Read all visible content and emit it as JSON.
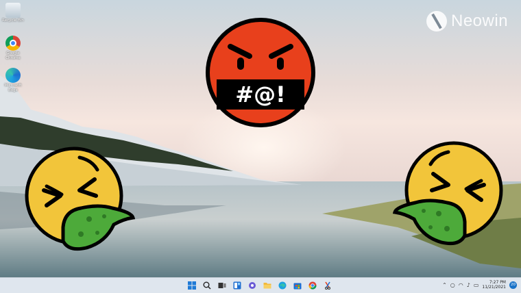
{
  "desktop": {
    "icons": [
      {
        "label": "Recycle Bin",
        "icon": "recycle-bin-icon"
      },
      {
        "label": "Google Chrome",
        "icon": "chrome-icon"
      },
      {
        "label": "Microsoft Edge",
        "icon": "edge-icon"
      }
    ]
  },
  "watermark": {
    "text": "Neowin",
    "icon": "neowin-logo-icon"
  },
  "emojis": {
    "swearing": {
      "text": "#@!",
      "icon": "face-with-symbols-on-mouth-icon",
      "color": "#e8401c"
    },
    "vomiting_left": {
      "icon": "face-vomiting-icon",
      "color": "#f2c53a"
    },
    "vomiting_right": {
      "icon": "face-vomiting-icon",
      "color": "#f2c53a"
    }
  },
  "taskbar": {
    "apps": [
      "windows-start-icon",
      "search-icon",
      "task-view-icon",
      "widgets-icon",
      "chat-icon",
      "file-explorer-icon",
      "edge-icon",
      "store-icon",
      "chrome-icon",
      "snipping-tool-icon"
    ],
    "tray_icons": [
      "chevron-up-icon",
      "network-icon",
      "wifi-icon",
      "volume-icon",
      "battery-icon"
    ],
    "time": "7:27 PM",
    "date": "11/21/2021",
    "notifications": "20"
  },
  "colors": {
    "taskbar": "#dfe6ee",
    "accent": "#1a73c8",
    "vomit": "#4daa3a"
  }
}
